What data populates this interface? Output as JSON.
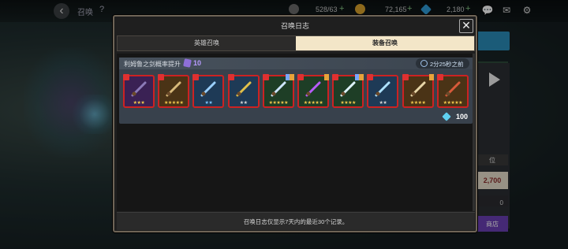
{
  "topbar": {
    "title": "召唤",
    "help": "?",
    "stamina": "528/63",
    "gold": "72,165",
    "gems": "2,180"
  },
  "side": {
    "price": "2,700",
    "small_value": "0",
    "shop_label": "商店",
    "label_top": "位"
  },
  "modal": {
    "title": "召唤日志",
    "tabs": [
      "英雄召唤",
      "装备召唤"
    ],
    "active_tab": 1,
    "footer": "召唤日志仅显示7天内的最近30个记录。"
  },
  "entry": {
    "label": "利姆鲁之剑概率提升",
    "ticket_count": "10",
    "time": "2分25秒之前",
    "cost": "100",
    "items": [
      {
        "name": "bow",
        "frame": "purple",
        "stars": "★★★",
        "star_color": "gold",
        "flags": []
      },
      {
        "name": "sword",
        "frame": "brown",
        "stars": "★★★★★",
        "star_color": "gold",
        "flags": []
      },
      {
        "name": "dagger",
        "frame": "blue",
        "stars": "★★",
        "star_color": "blue",
        "flags": []
      },
      {
        "name": "gauntlet",
        "frame": "blue",
        "stars": "★★",
        "star_color": "gray",
        "flags": []
      },
      {
        "name": "greatsword",
        "frame": "green",
        "stars": "★★★★★",
        "star_color": "gold",
        "flags": [
          "blue",
          "orange"
        ]
      },
      {
        "name": "gem-staff",
        "frame": "green",
        "stars": "★★★★★",
        "star_color": "gold",
        "flags": [
          "orange"
        ]
      },
      {
        "name": "holy-sword",
        "frame": "green",
        "stars": "★★★★",
        "star_color": "gold",
        "flags": [
          "blue",
          "orange"
        ]
      },
      {
        "name": "crossbow",
        "frame": "blue",
        "stars": "★★",
        "star_color": "gray",
        "flags": []
      },
      {
        "name": "axe",
        "frame": "brown",
        "stars": "★★★★",
        "star_color": "gold",
        "flags": [
          "orange"
        ]
      },
      {
        "name": "turtle-shield",
        "frame": "brown",
        "stars": "★★★★★",
        "star_color": "gold",
        "flags": []
      }
    ]
  },
  "colors": {
    "accent_gold": "#f2c94c",
    "frame_red": "#cc2222",
    "tab_active": "#f3e6c8",
    "ticket_purple": "#b89cff"
  }
}
